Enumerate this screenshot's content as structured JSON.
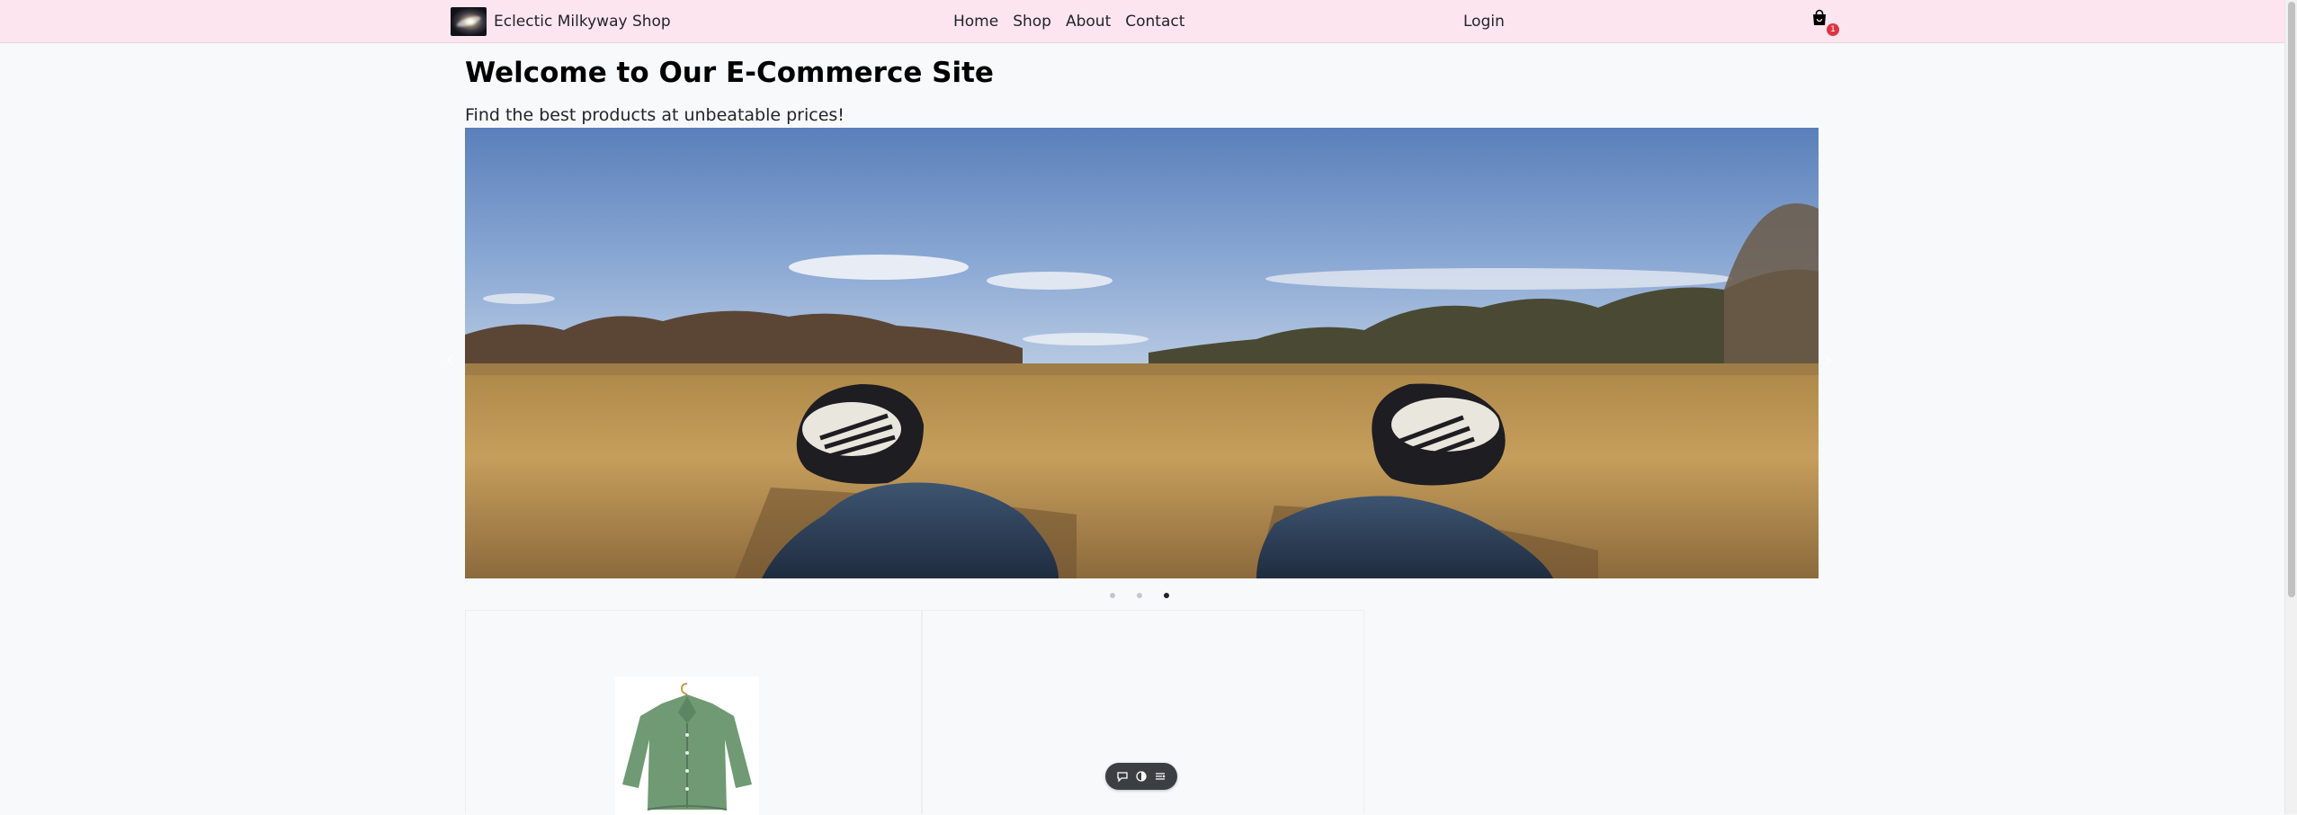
{
  "navbar": {
    "brand_name": "Eclectic Milkyway Shop",
    "links": [
      "Home",
      "Shop",
      "About",
      "Contact"
    ],
    "login_label": "Login",
    "cart_count": "1",
    "background_color": "#fde5ef"
  },
  "hero": {
    "title": "Welcome to Our E-Commerce Site",
    "subtitle": "Find the best products at unbeatable prices!"
  },
  "carousel": {
    "slide_count": 3,
    "active_index": 2,
    "prev_icon": "chevron-left-icon",
    "next_icon": "chevron-right-icon"
  },
  "products": {
    "first_item_image": "green-shirt-on-hanger"
  },
  "toolbar": {
    "icons": [
      "chat-bubble-icon",
      "toggle-view-icon",
      "list-settings-icon"
    ]
  },
  "colors": {
    "page_background": "#f8f9fa",
    "cart_badge": "#dc3545",
    "toolbar_background": "#3b3f44"
  }
}
